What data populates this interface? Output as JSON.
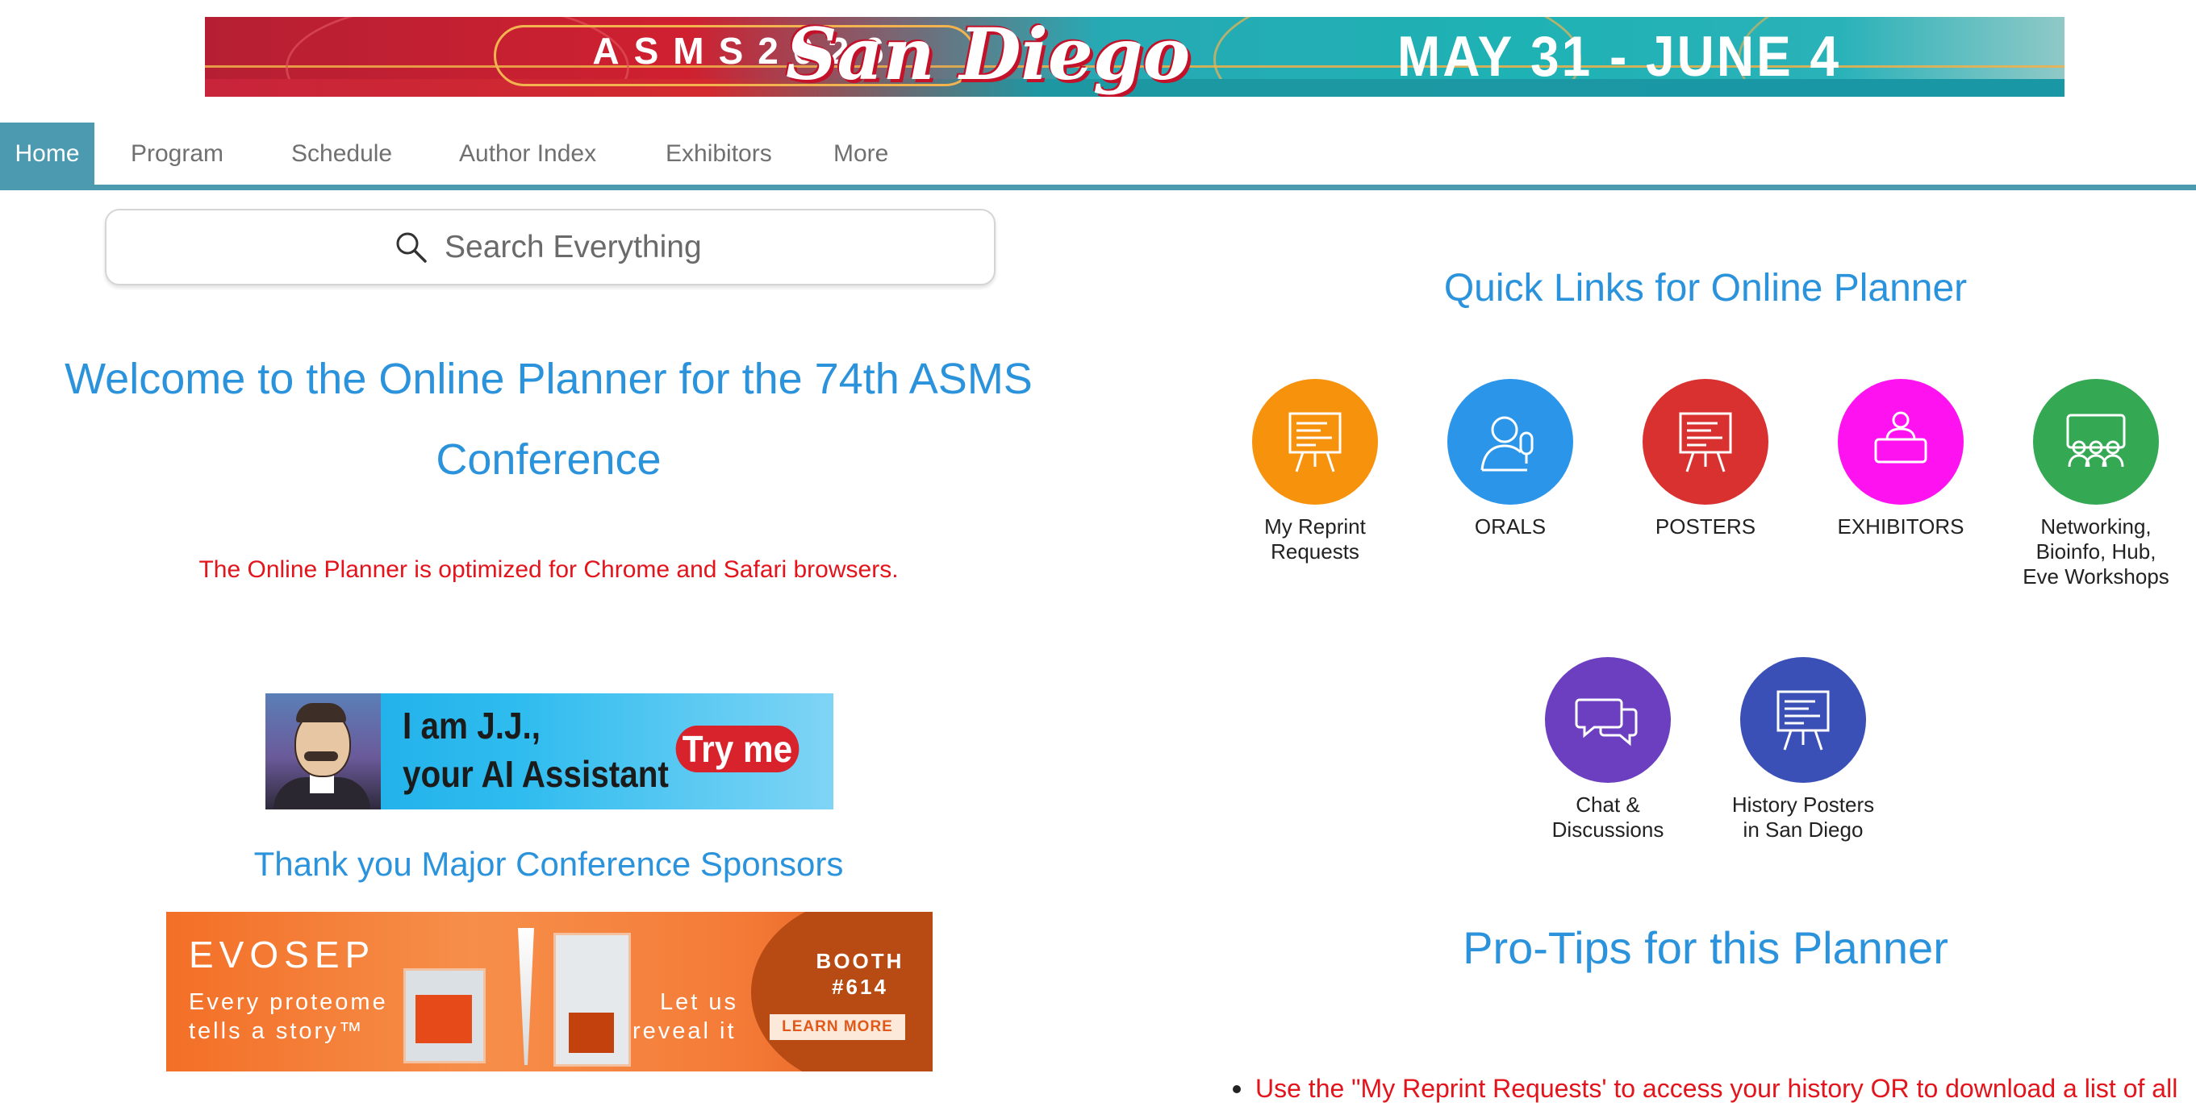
{
  "banner": {
    "asms": "ASMS2026",
    "city": "San Diego",
    "dates": "MAY 31 - JUNE 4"
  },
  "nav": {
    "tabs": [
      {
        "label": "Home",
        "active": true
      },
      {
        "label": "Program"
      },
      {
        "label": "Schedule"
      },
      {
        "label": "Author Index"
      },
      {
        "label": "Exhibitors"
      },
      {
        "label": "More"
      }
    ],
    "accent_color": "#4c9ab0"
  },
  "search": {
    "placeholder": "Search Everything"
  },
  "welcome": {
    "title_line1": "Welcome to the Online Planner for the 74th ASMS",
    "title_line2": "Conference",
    "notice": "The Online Planner is optimized for Chrome and Safari browsers."
  },
  "ai_ad": {
    "line1": "I am J.J.,",
    "line2": "your AI Assistant",
    "button": "Try me"
  },
  "sponsors": {
    "title": "Thank you Major Conference Sponsors",
    "evosep": {
      "logo": "EVOSEP",
      "tagline1": "Every proteome",
      "tagline2": "tells a story™",
      "reveal1": "Let us",
      "reveal2": "reveal it",
      "booth_label": "BOOTH",
      "booth_number": "#614",
      "cta": "LEARN MORE"
    }
  },
  "quick_links": {
    "title": "Quick Links for Online Planner",
    "items": [
      {
        "line1": "My Reprint",
        "line2": "Requests",
        "line3": "",
        "color": "#f7920c",
        "icon": "presentation-board-icon"
      },
      {
        "line1": "ORALS",
        "line2": "",
        "line3": "",
        "color": "#2b95ea",
        "icon": "speaker-microphone-icon"
      },
      {
        "line1": "POSTERS",
        "line2": "",
        "line3": "",
        "color": "#d93030",
        "icon": "poster-board-icon"
      },
      {
        "line1": "EXHIBITORS",
        "line2": "",
        "line3": "",
        "color": "#ff12f0",
        "icon": "exhibitor-booth-icon"
      },
      {
        "line1": "Networking,",
        "line2": "Bioinfo, Hub,",
        "line3": "Eve Workshops",
        "color": "#34a853",
        "icon": "group-meeting-icon"
      },
      {
        "line1": "Chat &",
        "line2": "Discussions",
        "line3": "",
        "color": "#6c3fc0",
        "icon": "chat-bubbles-icon"
      },
      {
        "line1": "History Posters",
        "line2": "in San Diego",
        "line3": "",
        "color": "#3a50b6",
        "icon": "history-poster-icon"
      }
    ]
  },
  "pro_tips": {
    "title": "Pro-Tips for this Planner",
    "tips": [
      "Use the \"My Reprint Requests' to access your history OR to download a list of all"
    ]
  }
}
